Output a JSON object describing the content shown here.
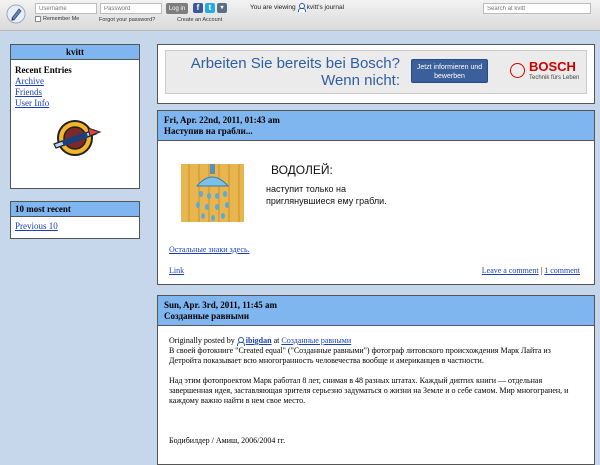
{
  "topbar": {
    "username_placeholder": "Username",
    "password_placeholder": "Password",
    "login_label": "Log in",
    "remember_label": "Remember Me",
    "forgot_label": "Forgot your password?",
    "create_label": "Create an Account",
    "viewing_prefix": "You are viewing",
    "viewing_suffix": "kvitt's journal",
    "search_placeholder": "Search at kvitt",
    "social_icons": [
      "facebook-icon",
      "twitter-icon",
      "dropdown-icon"
    ]
  },
  "sidebar": {
    "user_box": {
      "title": "kvitt",
      "section_title": "Recent Entries",
      "links": [
        "Archive",
        "Friends",
        "User Info"
      ]
    },
    "recent_box": {
      "title": "10 most recent",
      "link": "Previous 10"
    }
  },
  "ad": {
    "headline": "Arbeiten Sie bereits bei Bosch? Wenn nicht:",
    "cta": "Jetzt informieren und bewerben",
    "brand": "BOSCH",
    "tagline": "Technik fürs Leben"
  },
  "posts": [
    {
      "date": "Fri, Apr. 22nd, 2011, 01:43 am",
      "title": "Наступив на грабли...",
      "image_title": "ВОДОЛЕЙ:",
      "image_text": "наступит только на приглянувшиеся ему грабли.",
      "other_link": "Остальные знаки здесь.",
      "link_label": "Link",
      "leave_comment": "Leave a comment",
      "separator": "|",
      "comments": "1 comment"
    },
    {
      "date": "Sun, Apr. 3rd, 2011, 11:45 am",
      "title": "Созданные равными",
      "orig_prefix": "Originally posted by",
      "orig_user": "ibigdan",
      "orig_at": "at",
      "orig_link": "Созданные равными",
      "para1": "В своей фотокниге \"Created equal\" (\"Созданные равными\") фотограф литовского происхождения Марк Лайта из Детройта показывает всю многогранность человечества вообще и американцев в частности.",
      "para2": "Над этим фотопроектом Марк работал 8 лет, снимая в 48 разных штатах. Каждый диптих книги — отдельная завершенная идея, заставляющая зрителя серьезно задуматься о жизни на Земле и о себе самом. Мир многогранен, и каждому важно найти в нем свое место.",
      "caption": "Бодибилдер / Амиш, 2006/2004 гг."
    }
  ]
}
